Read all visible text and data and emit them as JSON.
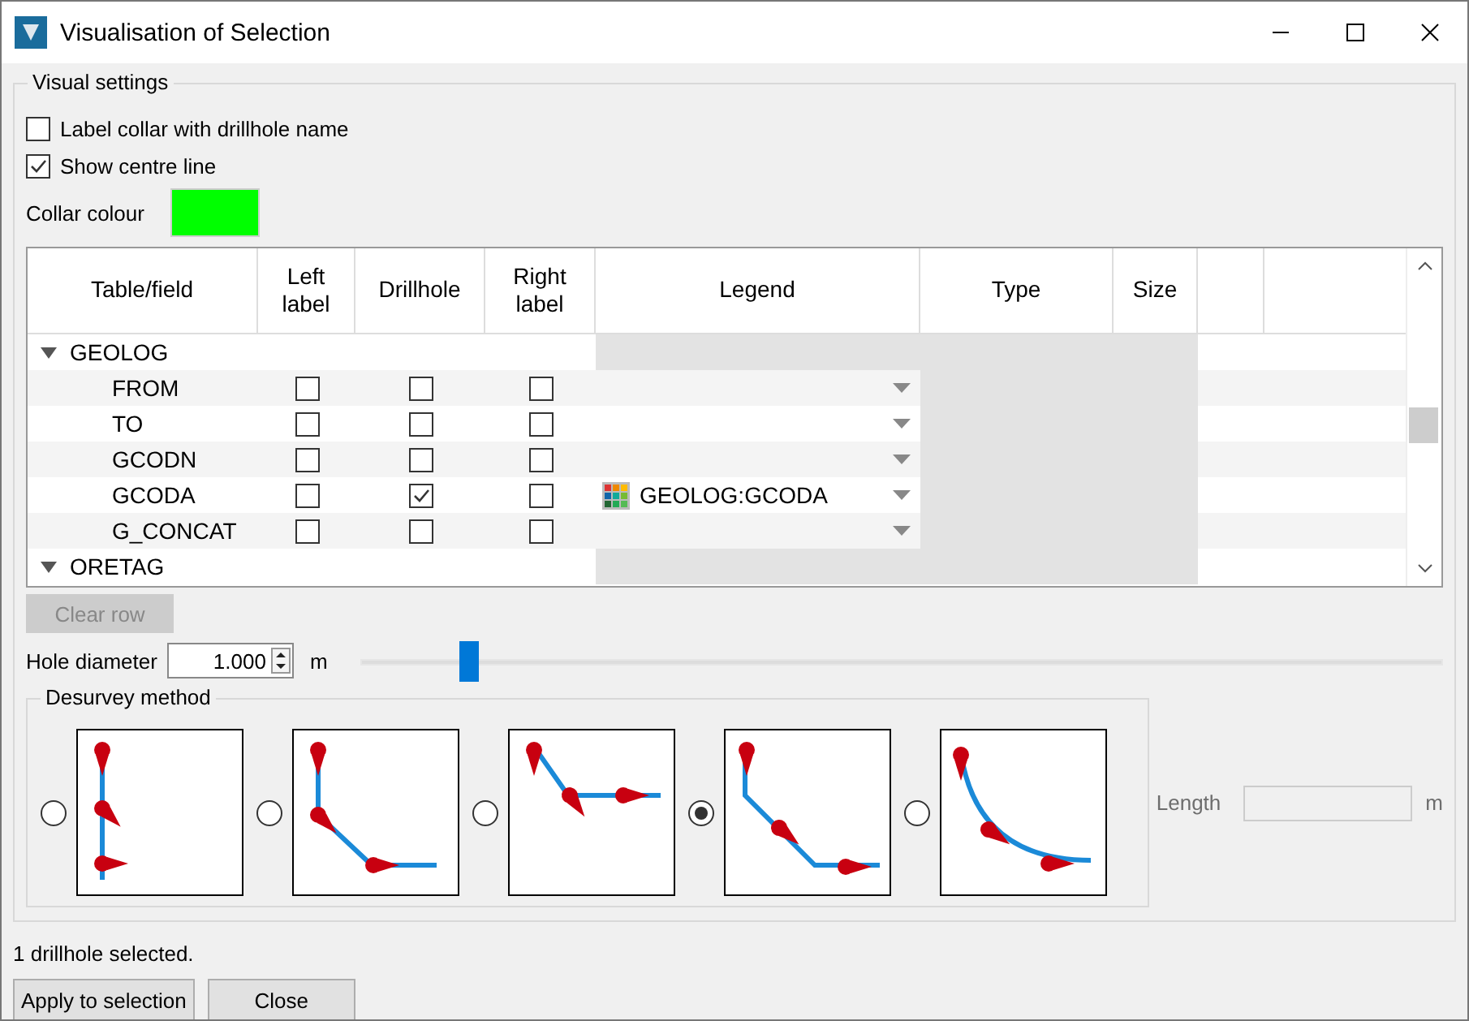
{
  "window": {
    "title": "Visualisation of Selection"
  },
  "visual_settings": {
    "title": "Visual settings",
    "options": [
      {
        "label": "Label collar with drillhole name",
        "checked": false
      },
      {
        "label": "Show centre line",
        "checked": true
      }
    ],
    "collar_colour": {
      "label": "Collar colour",
      "color": "#00ff00"
    }
  },
  "table": {
    "columns": [
      "Table/field",
      "Left label",
      "Drillhole",
      "Right label",
      "Legend",
      "Type",
      "Size"
    ],
    "groups": [
      {
        "name": "GEOLOG",
        "expanded": true,
        "children": [
          {
            "name": "FROM",
            "left_label": false,
            "drillhole": false,
            "right_label": false
          },
          {
            "name": "TO",
            "left_label": false,
            "drillhole": false,
            "right_label": false
          },
          {
            "name": "GCODN",
            "left_label": false,
            "drillhole": false,
            "right_label": false
          },
          {
            "name": "GCODA",
            "left_label": false,
            "drillhole": true,
            "right_label": false,
            "legend": "GEOLOG:GCODA"
          },
          {
            "name": "G_CONCAT",
            "left_label": false,
            "drillhole": false,
            "right_label": false
          }
        ]
      },
      {
        "name": "ORETAG",
        "expanded": true
      }
    ]
  },
  "clear_row": {
    "label": "Clear row",
    "disabled": true
  },
  "hole_diameter": {
    "label": "Hole diameter",
    "value": "1.000",
    "unit": "m",
    "level": 0.1
  },
  "desurvey": {
    "title": "Desurvey method",
    "methods": [
      {
        "kind": "straight",
        "selected": false
      },
      {
        "kind": "bend",
        "selected": false
      },
      {
        "kind": "early-bend",
        "selected": false
      },
      {
        "kind": "double-bend",
        "selected": true
      },
      {
        "kind": "curve",
        "selected": false
      }
    ],
    "length": {
      "label": "Length",
      "unit": "m",
      "disabled": true
    }
  },
  "status": "1 drillhole selected.",
  "buttons": [
    "Apply to selection",
    "Close"
  ]
}
